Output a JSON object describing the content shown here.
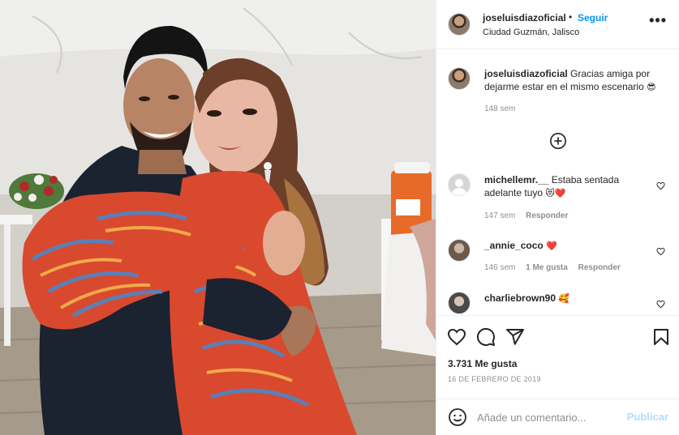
{
  "post": {
    "author": "joseluisdiazoficial",
    "dot": "•",
    "follow_label": "Seguir",
    "location": "Ciudad Guzmán, Jalisco",
    "more_label": "•••",
    "photo_alt": "Foto de la publicación"
  },
  "caption": {
    "user": "joseluisdiazoficial",
    "text": "Gracias amiga por dejarme estar en el mismo escenario",
    "emoji": "😎",
    "time": "148 sem"
  },
  "load_more_icon": "plus-circle-icon",
  "comments": [
    {
      "user": "michellemr.__",
      "text": "Estaba sentada adelante tuyo",
      "emoji": "😻❤️",
      "time": "147 sem",
      "likes": "",
      "reply": "Responder"
    },
    {
      "user": "_annie_coco",
      "text": "",
      "emoji": "❤️",
      "time": "146 sem",
      "likes": "1 Me gusta",
      "reply": "Responder"
    },
    {
      "user": "charliebrown90",
      "text": "",
      "emoji": "🥰",
      "time": "",
      "likes": "",
      "reply": ""
    }
  ],
  "actions": {
    "like_icon": "heart-icon",
    "comment_icon": "comment-icon",
    "share_icon": "paper-plane-icon",
    "save_icon": "bookmark-icon"
  },
  "likes_text": "3.731 Me gusta",
  "date_text": "16 DE FEBRERO DE 2019",
  "add_comment": {
    "placeholder": "Añade un comentario...",
    "publish_label": "Publicar",
    "emoji_icon": "smiley-icon"
  },
  "colors": {
    "accent": "#0095f6",
    "publish_disabled": "#b3dbff",
    "muted": "#8e8e8e",
    "text": "#262626",
    "divider": "#efefef"
  }
}
